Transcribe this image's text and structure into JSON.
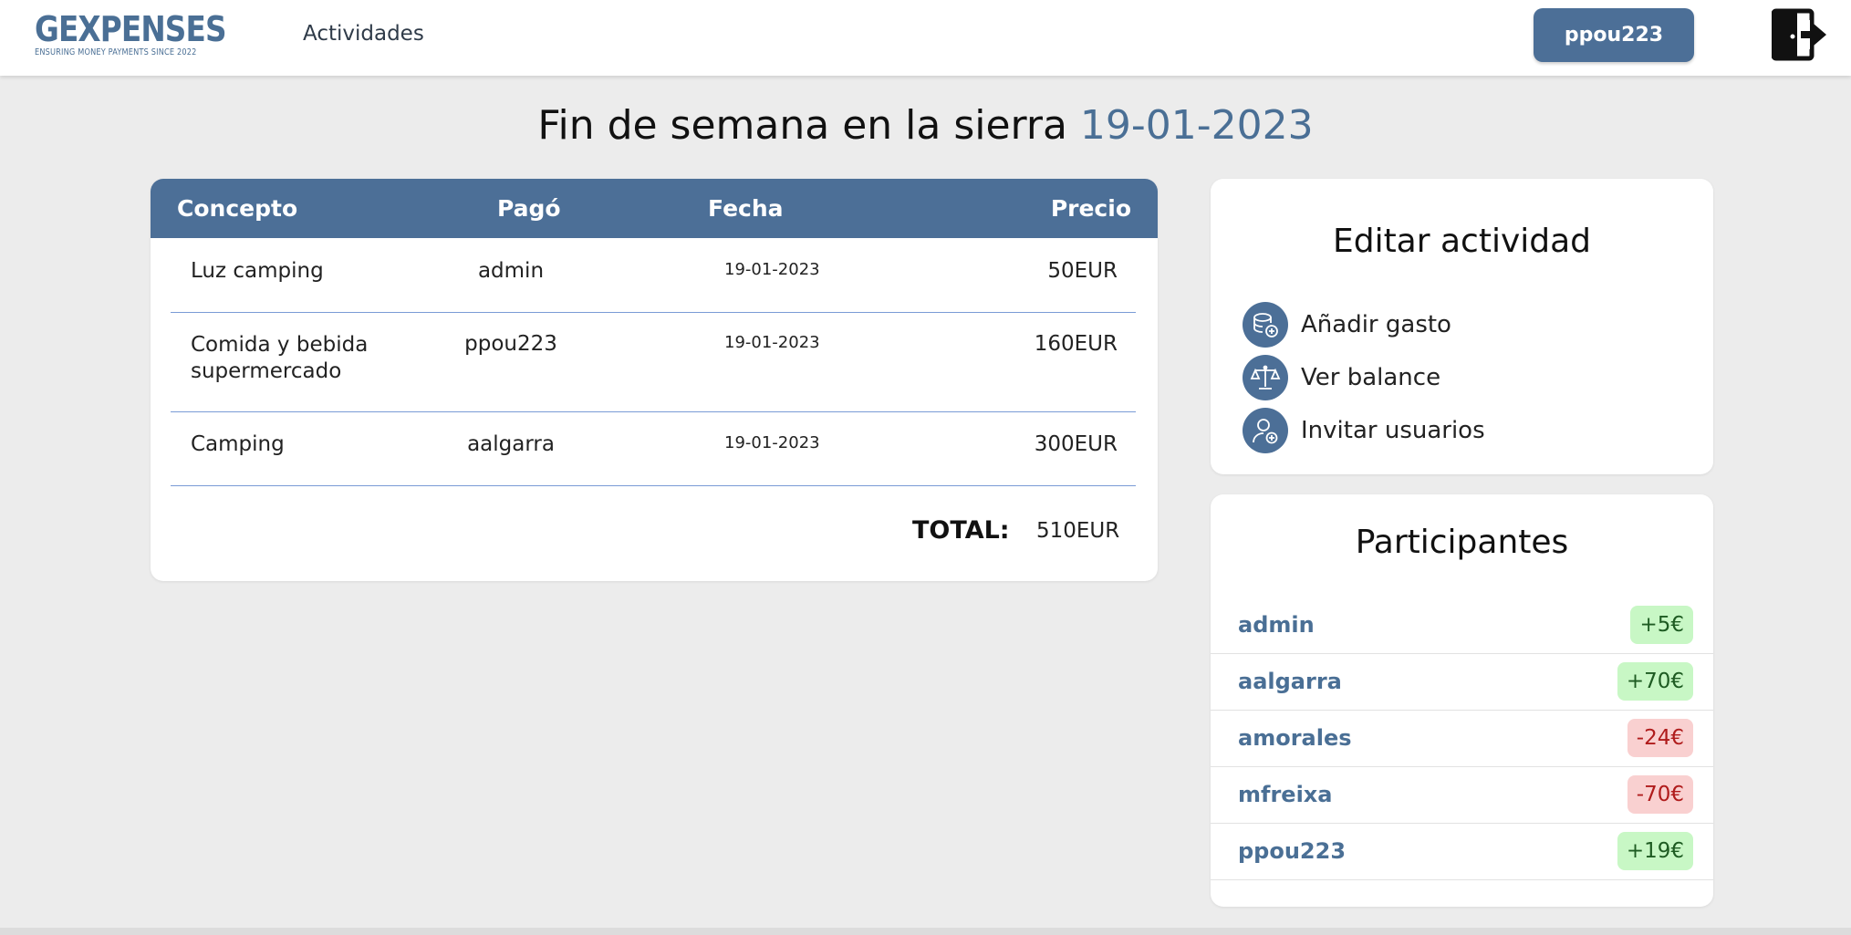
{
  "brand": {
    "name": "GEXPENSES",
    "tagline": "ENSURING MONEY PAYMENTS SINCE 2022"
  },
  "nav": {
    "activities_link": "Actividades",
    "user_button": "ppou223",
    "logout_icon": "logout-icon"
  },
  "page": {
    "title": "Fin de semana en la sierra",
    "date": "19-01-2023"
  },
  "expenses": {
    "headers": [
      "Concepto",
      "Pagó",
      "Fecha",
      "Precio"
    ],
    "rows": [
      {
        "concept": "Luz camping",
        "paid_by": "admin",
        "date": "19-01-2023",
        "price": "50EUR"
      },
      {
        "concept": "Comida y bebida supermercado",
        "paid_by": "ppou223",
        "date": "19-01-2023",
        "price": "160EUR"
      },
      {
        "concept": "Camping",
        "paid_by": "aalgarra",
        "date": "19-01-2023",
        "price": "300EUR"
      }
    ],
    "total_label": "TOTAL:",
    "total_value": "510EUR"
  },
  "edit_activity": {
    "title": "Editar actividad",
    "actions": [
      {
        "label": "Añadir gasto",
        "icon": "add-expense-icon"
      },
      {
        "label": "Ver balance",
        "icon": "balance-scale-icon"
      },
      {
        "label": "Invitar usuarios",
        "icon": "invite-user-icon"
      }
    ]
  },
  "participants": {
    "title": "Participantes",
    "list": [
      {
        "name": "admin",
        "balance": "+5€",
        "status": "positive"
      },
      {
        "name": "aalgarra",
        "balance": "+70€",
        "status": "positive"
      },
      {
        "name": "amorales",
        "balance": "-24€",
        "status": "negative"
      },
      {
        "name": "mfreixa",
        "balance": "-70€",
        "status": "negative"
      },
      {
        "name": "ppou223",
        "balance": "+19€",
        "status": "positive"
      }
    ]
  },
  "colors": {
    "primary": "#4c6f97",
    "background": "#ececec",
    "positive_bg": "#c8f7c5",
    "negative_bg": "#f9d0d0"
  }
}
